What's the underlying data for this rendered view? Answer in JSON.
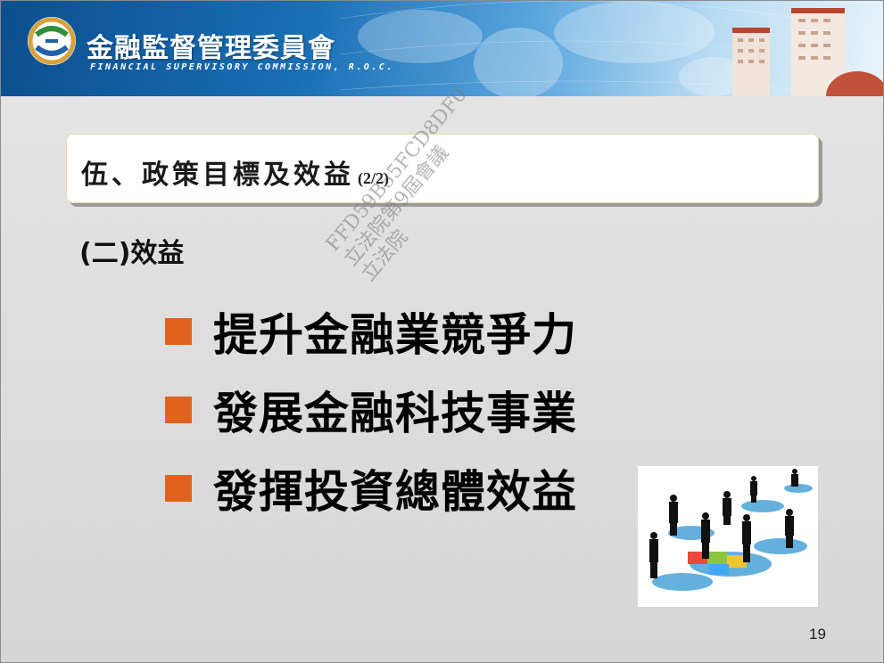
{
  "header": {
    "org_name_zh": "金融監督管理委員會",
    "org_name_en": "FINANCIAL SUPERVISORY COMMISSION, R.O.C."
  },
  "slide": {
    "title": "伍、政策目標及效益",
    "title_suffix": "(2/2)",
    "subheading": "(二)效益",
    "bullets": [
      {
        "text": "提升金融業競爭力"
      },
      {
        "text": "發展金融科技事業"
      },
      {
        "text": "發揮投資總體效益"
      }
    ],
    "page_number": "19"
  },
  "watermark": {
    "line1": "FFD59B55FCD8DF0",
    "line2": "立法院第9屆會議",
    "line3": "立法院"
  },
  "colors": {
    "bullet": "#e0621c",
    "banner_dark": "#0b4f8f",
    "background": "#d9d9d9"
  },
  "icons": {
    "emblem": "fsc-logo-emblem",
    "illustration": "business-people-puzzle-illustration"
  }
}
